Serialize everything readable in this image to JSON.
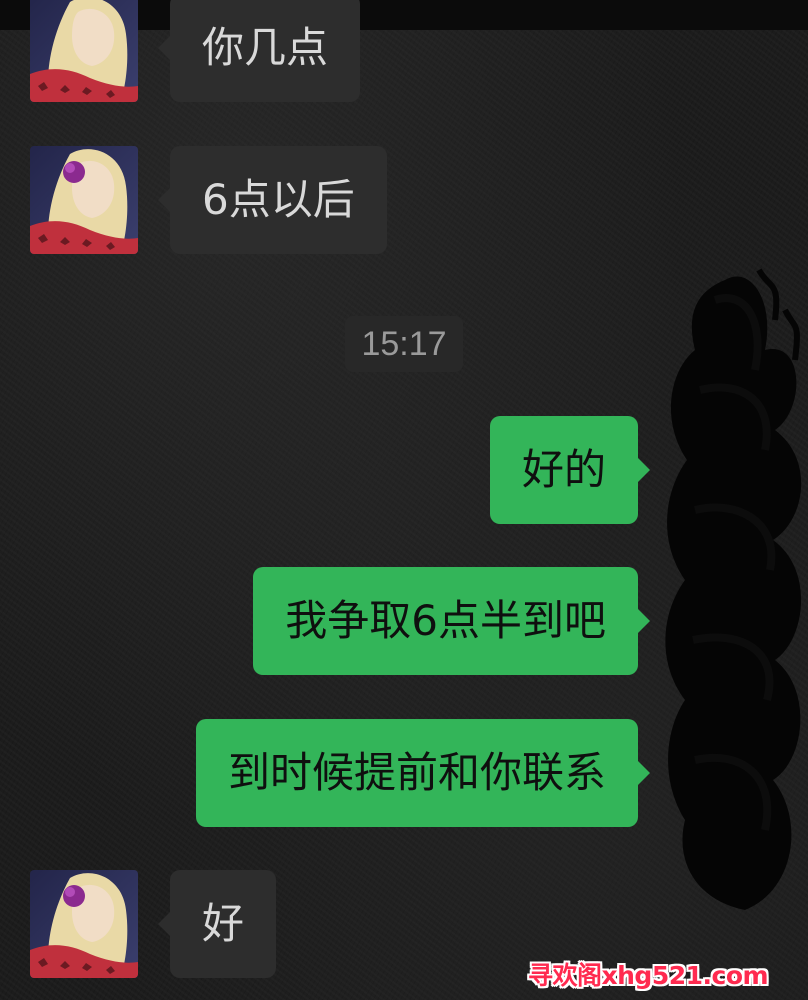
{
  "messages": [
    {
      "side": "in",
      "text": "你几点"
    },
    {
      "side": "in",
      "text": "6点以后"
    },
    {
      "side": "out",
      "text": "好的"
    },
    {
      "side": "out",
      "text": "我争取6点半到吧"
    },
    {
      "side": "out",
      "text": "到时候提前和你联系"
    },
    {
      "side": "in",
      "text": "好"
    }
  ],
  "timestamp": "15:17",
  "watermark": "寻欢阁xhg521.com",
  "colors": {
    "incoming_bubble": "#2d2d2d",
    "outgoing_bubble": "#33b559",
    "background": "#1c1c1c",
    "watermark": "#ff2a4f"
  },
  "icons": {
    "avatar": "contact-photo-avatar",
    "redaction": "black-scribble-redaction"
  }
}
